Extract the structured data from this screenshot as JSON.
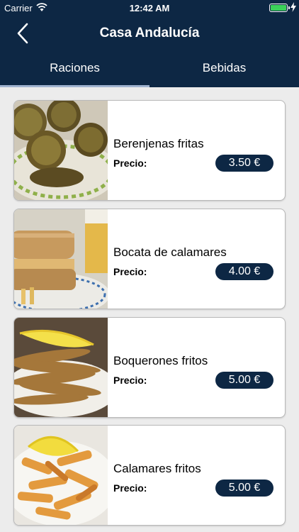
{
  "status_bar": {
    "carrier": "Carrier",
    "time": "12:42 AM"
  },
  "nav": {
    "title": "Casa Andalucía"
  },
  "tabs": [
    {
      "label": "Raciones",
      "selected": true
    },
    {
      "label": "Bebidas",
      "selected": false
    }
  ],
  "price_label": "Precio:",
  "items": [
    {
      "name": "Berenjenas fritas",
      "price": "3.50 €"
    },
    {
      "name": "Bocata de calamares",
      "price": "4.00 €"
    },
    {
      "name": "Boquerones fritos",
      "price": "5.00 €"
    },
    {
      "name": "Calamares fritos",
      "price": "5.00 €"
    }
  ],
  "colors": {
    "header": "#0d2744",
    "tab_indicator": "#9fb3d0",
    "background": "#ececec"
  }
}
